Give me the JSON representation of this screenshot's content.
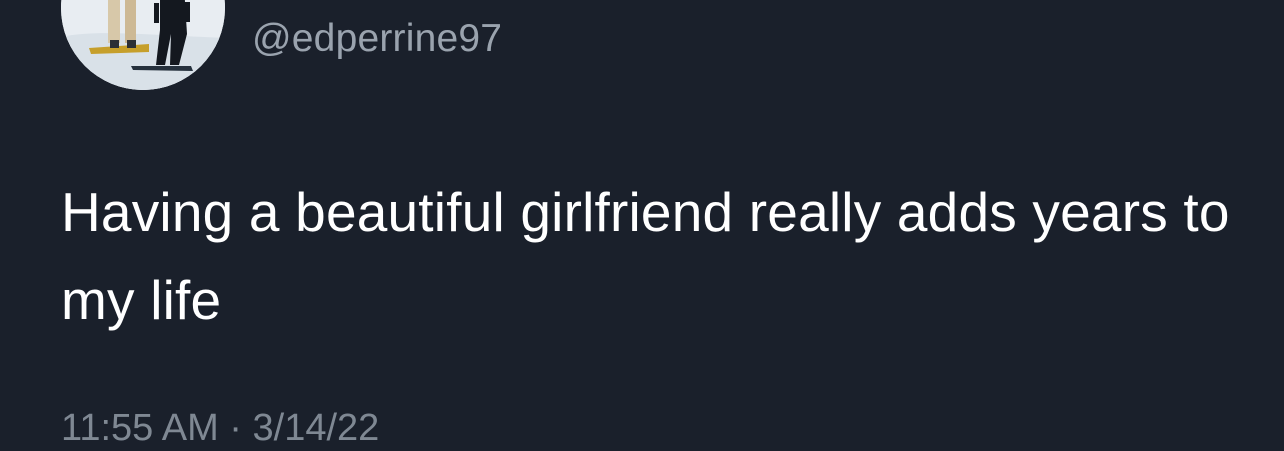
{
  "tweet": {
    "avatar_icon": "profile-photo-snowboarders-icon",
    "handle": "@edperrine97",
    "text": "Having a beautiful girlfriend really adds years to my life",
    "timestamp_visible_fragment": "11:55 AM · 3/14/22"
  }
}
